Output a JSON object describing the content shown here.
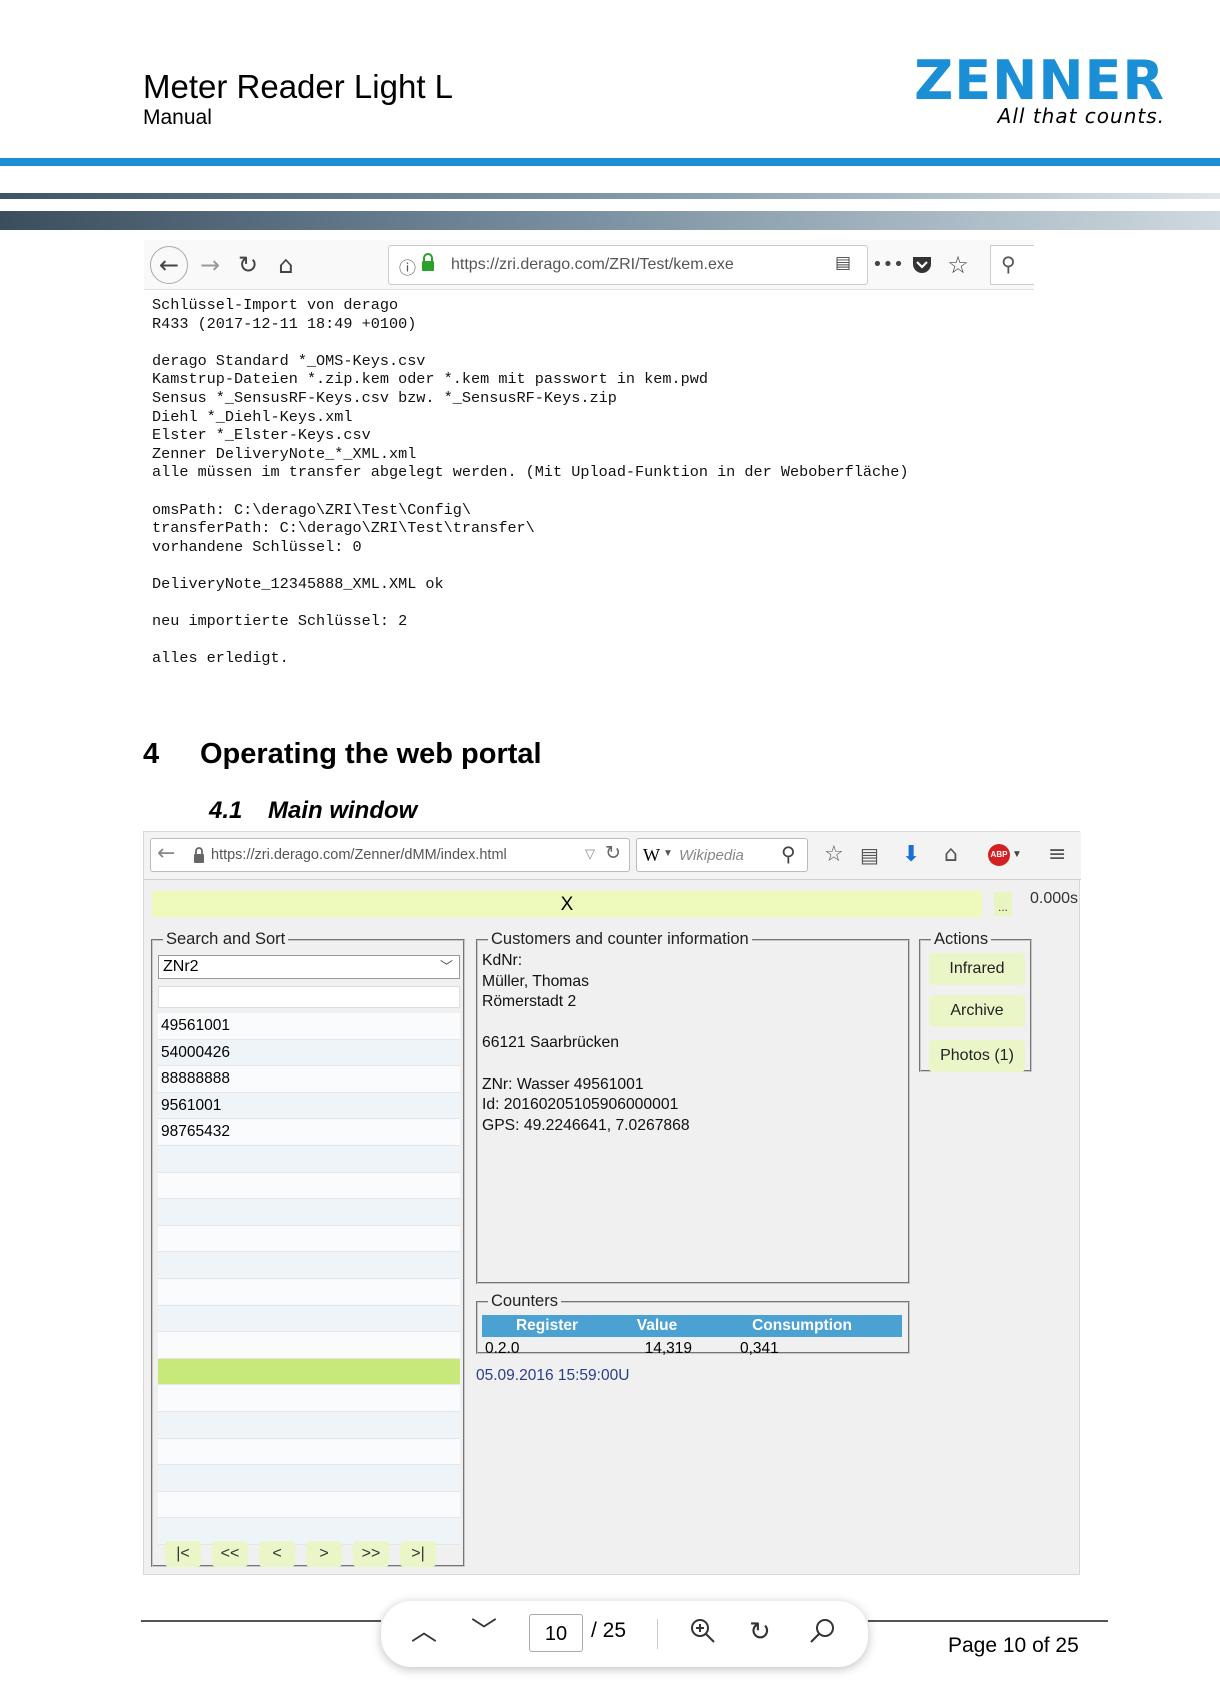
{
  "header": {
    "title": "Meter Reader Light L",
    "subtitle": "Manual",
    "logo_word": "ZENNER",
    "logo_tagline": "All that counts.",
    "brand_color": "#1a8fd6"
  },
  "screenshot1": {
    "url": "https://zri.derago.com/ZRI/Test/kem.exe",
    "console_lines": [
      "Schlüssel-Import von derago",
      "R433 (2017-12-11 18:49 +0100)",
      "",
      "derago Standard *_OMS-Keys.csv",
      "Kamstrup-Dateien *.zip.kem oder *.kem mit passwort in kem.pwd",
      "Sensus *_SensusRF-Keys.csv bzw. *_SensusRF-Keys.zip",
      "Diehl *_Diehl-Keys.xml",
      "Elster *_Elster-Keys.csv",
      "Zenner DeliveryNote_*_XML.xml",
      "alle müssen im transfer abgelegt werden. (Mit Upload-Funktion in der Weboberfläche)",
      "",
      "omsPath: C:\\derago\\ZRI\\Test\\Config\\",
      "transferPath: C:\\derago\\ZRI\\Test\\transfer\\",
      "vorhandene Schlüssel: 0",
      "",
      "DeliveryNote_12345888_XML.XML ok",
      "",
      "neu importierte Schlüssel: 2",
      "",
      "alles erledigt."
    ]
  },
  "section": {
    "number": "4",
    "title": "Operating the web portal",
    "sub_number": "4.1",
    "sub_title": "Main window"
  },
  "screenshot2": {
    "url": "https://zri.derago.com/Zenner/dMM/index.html",
    "search_placeholder": "Wikipedia",
    "status_text": "X",
    "dots": "...",
    "timer": "0.000s",
    "search_sort": {
      "legend": "Search and Sort",
      "selected": "ZNr2",
      "items": [
        "49561001",
        "54000426",
        "88888888",
        "9561001",
        "98765432",
        "",
        "",
        "",
        "",
        "",
        "",
        "",
        "",
        "",
        "",
        "",
        "",
        "",
        "",
        ""
      ],
      "selected_index": 13,
      "pager": [
        "|<",
        "<<",
        "<",
        ">",
        ">>",
        ">|"
      ]
    },
    "customer": {
      "legend": "Customers and counter information",
      "lines": [
        "KdNr:",
        "Müller, Thomas",
        "Römerstadt 2",
        "",
        "66121 Saarbrücken",
        "",
        "ZNr: Wasser 49561001",
        "Id: 20160205105906000001",
        "GPS: 49.2246641, 7.0267868"
      ]
    },
    "actions": {
      "legend": "Actions",
      "buttons": [
        "Infrared",
        "Archive",
        "Photos (1)"
      ]
    },
    "counters": {
      "legend": "Counters",
      "headers": [
        "Register",
        "Value",
        "Consumption"
      ],
      "rows": [
        [
          "0.2.0",
          "14,319",
          "0,341"
        ]
      ]
    },
    "timestamp": "05.09.2016 15:59:00U"
  },
  "pdf_viewer": {
    "current_page": "10",
    "total": "/ 25"
  },
  "footer": {
    "page_label": "Page 10 of 25"
  }
}
